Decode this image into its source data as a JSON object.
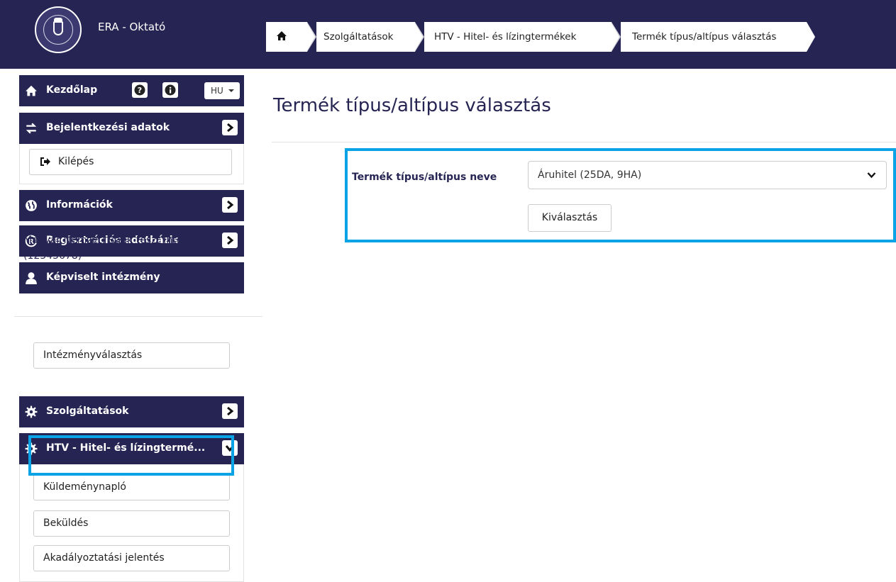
{
  "header": {
    "app_title": "ERA - Oktató",
    "home_icon": "home-icon",
    "breadcrumb": [
      "Szolgáltatások",
      "HTV - Hitel- és lízingtermékek",
      "Termék típus/altípus választás"
    ]
  },
  "sidebar": {
    "home_label": "Kezdőlap",
    "language": "HU",
    "login_data_label": "Bejelentkezési adatok",
    "logout_label": "Kilépés",
    "info_label": "Információk",
    "registry_label": "Regisztrációs adatbázis",
    "represented_label": "Képviselt intézmény",
    "institution_name": "Magyar Nemzeti Bank teszt intézménye (12345678)",
    "institution_select_label": "Intézményválasztás",
    "services_label": "Szolgáltatások",
    "htv_label": "HTV - Hitel- és lízingtermé...",
    "htv_items": [
      "Küldeménynapló",
      "Beküldés",
      "Akadályoztatási jelentés"
    ]
  },
  "main": {
    "page_title": "Termék típus/altípus választás",
    "field_label": "Termék típus/altípus neve",
    "selected_value": "Áruhitel (25DA, 9HA)",
    "submit_label": "Kiválasztás"
  },
  "colors": {
    "header_bg": "#262453",
    "highlight": "#0aa3e6",
    "text_accent": "#262453"
  }
}
